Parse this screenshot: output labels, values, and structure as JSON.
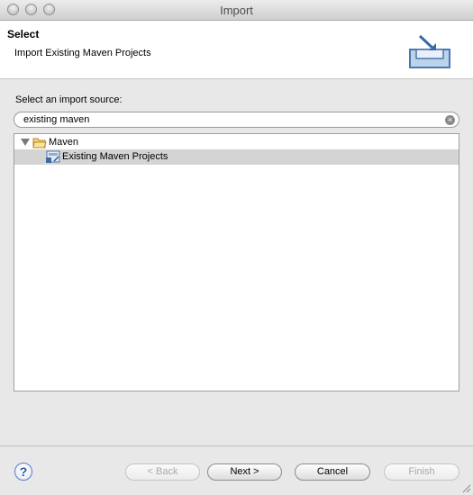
{
  "window": {
    "title": "Import"
  },
  "header": {
    "title": "Select",
    "description": "Import Existing Maven Projects",
    "icon": "import-wizard-icon"
  },
  "source": {
    "label": "Select an import source:",
    "filter_value": "existing maven"
  },
  "tree": {
    "items": [
      {
        "label": "Maven",
        "icon": "folder-icon",
        "expanded": true
      },
      {
        "label": "Existing Maven Projects",
        "icon": "maven-project-icon",
        "selected": true
      }
    ]
  },
  "buttons": {
    "back": "< Back",
    "next": "Next >",
    "cancel": "Cancel",
    "finish": "Finish"
  }
}
